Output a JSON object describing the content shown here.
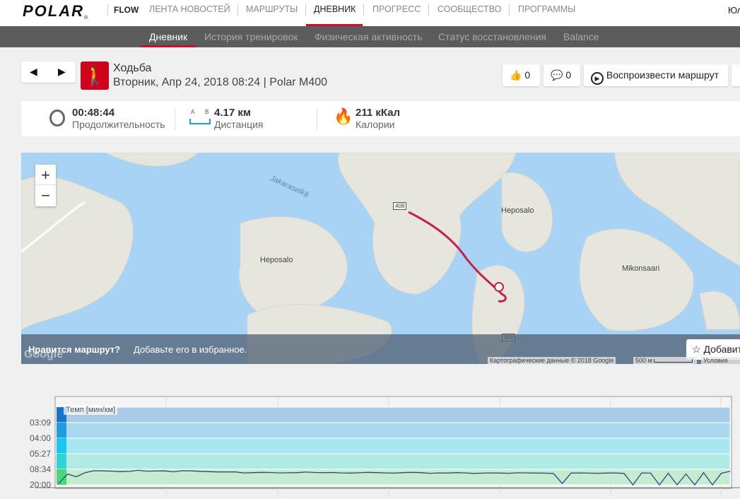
{
  "topnav": {
    "logo": "POLAR",
    "flow": "FLOW",
    "items": [
      "ЛЕНТА НОВОСТЕЙ",
      "МАРШРУТЫ",
      "ДНЕВНИК",
      "ПРОГРЕСС",
      "СООБЩЕСТВО",
      "ПРОГРАММЫ"
    ],
    "active": "ДНЕВНИК",
    "user": "Юл"
  },
  "subnav": {
    "items": [
      "Дневник",
      "История тренировок",
      "Физическая активность",
      "Статус восстановления",
      "Balance"
    ],
    "active": "Дневник"
  },
  "session": {
    "sport": "Ходьба",
    "datetime": "Вторник, Апр 24, 2018 08:24 | Polar M400",
    "likes": "0",
    "comments": "0",
    "replay": "Воспроизвести маршрут"
  },
  "summary": {
    "duration": {
      "value": "00:48:44",
      "label": "Продолжительность"
    },
    "distance": {
      "value": "4.17 км",
      "label": "Дистанция",
      "icon_a": "A",
      "icon_b": "B"
    },
    "calories": {
      "value": "211 кКал",
      "label": "Калории"
    }
  },
  "map": {
    "labels": [
      "Jakaraselkä",
      "Heposalo",
      "Heposalo",
      "Mikonsaari",
      "408",
      "408"
    ],
    "banner_bold": "Нравится маршрут?",
    "banner_text": "Добавьте его в избранное.",
    "favorite": "Добавить",
    "attribution": "Картографические данные © 2018 Google",
    "scale": "500 м",
    "terms": "Условия использования",
    "google": "Google",
    "zoom_in": "+",
    "zoom_out": "−"
  },
  "chart_data": {
    "type": "line",
    "title": "Темп [мин/км]",
    "yticks": [
      "03:09",
      "04:00",
      "05:27",
      "08:34",
      "20:00"
    ],
    "ytick_minutes": [
      3.15,
      4.0,
      5.45,
      8.57,
      20.0
    ],
    "zone_colors": [
      "#1a73c9",
      "#1f9de0",
      "#14c8f0",
      "#2ed3d3",
      "#4ad67a"
    ],
    "series": [
      {
        "name": "Темп",
        "values": [
          19,
          12,
          14,
          11,
          9.6,
          9.7,
          9.9,
          10.3,
          10.1,
          9.3,
          9.9,
          9.8,
          9.7,
          10.4,
          9.6,
          9.7,
          10,
          10.3,
          10.5,
          10.5,
          10.5,
          11.2,
          11,
          10.8,
          10.9,
          11.2,
          11.1,
          11,
          10.6,
          10.9,
          11,
          10.9,
          11.2,
          11.3,
          11.1,
          10.8,
          11,
          11.2,
          11.4,
          11,
          10.8,
          11,
          11.5,
          11.2,
          11.3,
          11,
          11.2,
          11.6,
          11.4,
          11.2,
          11.3,
          11.5,
          11.1,
          11.2,
          11.3,
          11.4,
          11.6,
          19,
          11.3,
          11.2,
          11.4,
          11.5,
          11.3,
          11.2,
          11.6,
          20,
          11.2,
          11.4,
          20,
          11.5,
          20,
          12,
          20,
          11,
          20,
          11.5,
          10
        ]
      }
    ]
  }
}
